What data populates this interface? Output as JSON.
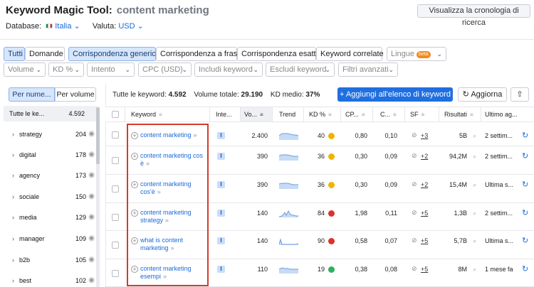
{
  "header": {
    "tool_name": "Keyword Magic Tool:",
    "keyword": "content marketing",
    "history_button": "Visualizza la cronologia di ricerca"
  },
  "db": {
    "db_label": "Database:",
    "db_value": "Italia",
    "currency_label": "Valuta:",
    "currency_value": "USD"
  },
  "tabs": {
    "all": "Tutti",
    "questions": "Domande"
  },
  "match": {
    "generic": "Corrispondenza generica",
    "phrase": "Corrispondenza a frase",
    "exact": "Corrispondenza esatta",
    "related": "Keyword correlate"
  },
  "lang": {
    "label": "Lingue",
    "beta": "beta"
  },
  "filters": {
    "volume": "Volume",
    "kd": "KD %",
    "intent": "Intento",
    "cpc": "CPC (USD)",
    "include": "Includi keyword",
    "exclude": "Escludi keyword",
    "advanced": "Filtri avanzati"
  },
  "side": {
    "by_number": "Per nume...",
    "by_volume": "Per volume",
    "all_label": "Tutte le ke...",
    "all_count": "4.592",
    "items": [
      {
        "label": "strategy",
        "count": "204"
      },
      {
        "label": "digital",
        "count": "178"
      },
      {
        "label": "agency",
        "count": "173"
      },
      {
        "label": "sociale",
        "count": "150"
      },
      {
        "label": "media",
        "count": "129"
      },
      {
        "label": "manager",
        "count": "109"
      },
      {
        "label": "b2b",
        "count": "105"
      },
      {
        "label": "best",
        "count": "102"
      }
    ]
  },
  "stats": {
    "all_label": "Tutte le keyword:",
    "all_value": "4.592",
    "vol_label": "Volume totale:",
    "vol_value": "29.190",
    "kd_label": "KD medio:",
    "kd_value": "37%"
  },
  "actions": {
    "add": "Aggiungi all'elenco di keyword",
    "refresh": "Aggiorna"
  },
  "columns": {
    "keyword": "Keyword",
    "intent": "Inte...",
    "volume": "Vo...",
    "trend": "Trend",
    "kd": "KD %",
    "cpc": "CP...",
    "com": "C...",
    "sf": "SF",
    "results": "Risultati",
    "updated": "Ultimo ag..."
  },
  "rows": [
    {
      "kw1": "content marketing",
      "kw2": "",
      "intent": "I",
      "volume": "2.400",
      "kd": "40",
      "kd_color": "#f2b300",
      "cpc": "0,80",
      "com": "0,10",
      "sf": "+3",
      "results": "5B",
      "updated": "2 settim..."
    },
    {
      "kw1": "content marketing cos",
      "kw2": "è",
      "intent": "I",
      "volume": "390",
      "kd": "36",
      "kd_color": "#f2b300",
      "cpc": "0,30",
      "com": "0,09",
      "sf": "+2",
      "results": "94,2M",
      "updated": "2 settim..."
    },
    {
      "kw1": "content marketing",
      "kw2": "cos'è",
      "intent": "I",
      "volume": "390",
      "kd": "36",
      "kd_color": "#f2b300",
      "cpc": "0,30",
      "com": "0,09",
      "sf": "+2",
      "results": "15,4M",
      "updated": "Ultima s..."
    },
    {
      "kw1": "content marketing",
      "kw2": "strategy",
      "intent": "I",
      "volume": "140",
      "kd": "84",
      "kd_color": "#d9342b",
      "cpc": "1,98",
      "com": "0,11",
      "sf": "+5",
      "results": "1,3B",
      "updated": "2 settim..."
    },
    {
      "kw1": "what is content",
      "kw2": "marketing",
      "intent": "I",
      "volume": "140",
      "kd": "90",
      "kd_color": "#d9342b",
      "cpc": "0,58",
      "com": "0,07",
      "sf": "+5",
      "results": "5,7B",
      "updated": "Ultima s..."
    },
    {
      "kw1": "content marketing",
      "kw2": "esempi",
      "intent": "I",
      "volume": "110",
      "kd": "19",
      "kd_color": "#2bb35a",
      "cpc": "0,38",
      "com": "0,08",
      "sf": "+5",
      "results": "8M",
      "updated": "1 mese fa"
    }
  ]
}
